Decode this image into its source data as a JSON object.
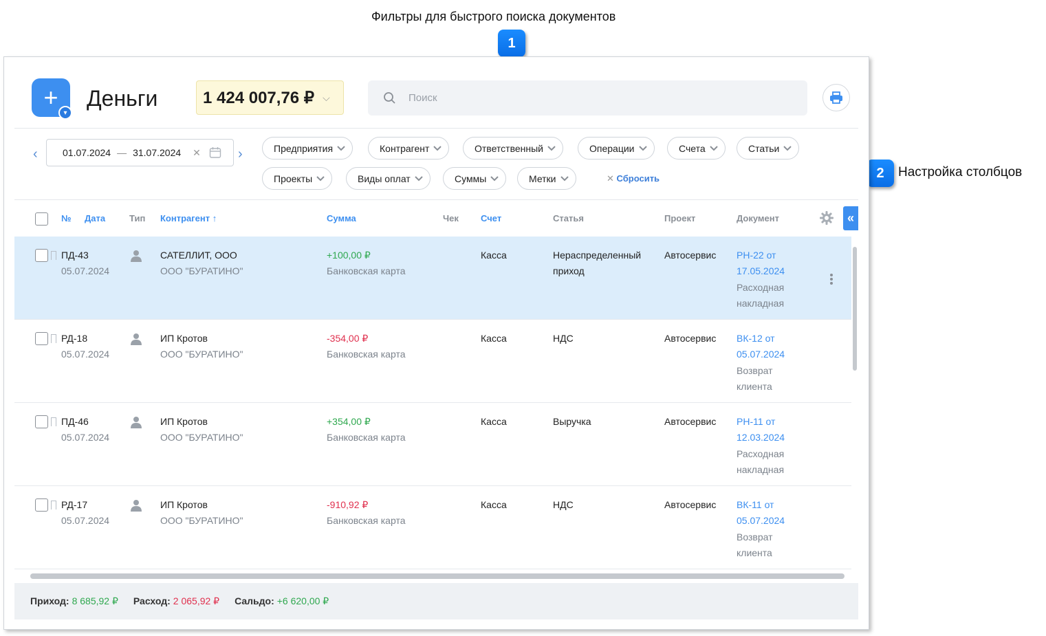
{
  "callouts": {
    "title": "Фильтры для быстрого поиска документов",
    "badge1": "1",
    "badge2": "2",
    "side_label": "Настройка столбцов"
  },
  "header": {
    "title": "Деньги",
    "balance": "1 424 007,76 ₽",
    "search_placeholder": "Поиск"
  },
  "period": {
    "from": "01.07.2024",
    "dash": "—",
    "to": "31.07.2024"
  },
  "filters": {
    "row1": [
      "Предприятия",
      "Контрагент",
      "Ответственный",
      "Операции",
      "Счета",
      "Статьи"
    ],
    "row2": [
      "Проекты",
      "Виды оплат",
      "Суммы",
      "Метки"
    ],
    "reset": "Сбросить"
  },
  "columns": {
    "num": "№",
    "date": "Дата",
    "type": "Тип",
    "counterparty": "Контрагент ↑",
    "sum": "Сумма",
    "check": "Чек",
    "account": "Счет",
    "article": "Статья",
    "project": "Проект",
    "document": "Документ"
  },
  "rows": [
    {
      "num": "ПД-43",
      "date": "05.07.2024",
      "counterparty": "САТЕЛЛИТ, ООО",
      "company": "ООО \"БУРАТИНО\"",
      "sum": "+100,00 ₽",
      "payment": "Банковская карта",
      "account": "Касса",
      "article_1": "Нераспределенный",
      "article_2": "приход",
      "project": "Автосервис",
      "doc_1": "РН-22 от",
      "doc_2": "17.05.2024",
      "doc_3": "Расходная",
      "doc_4": "накладная"
    },
    {
      "num": "РД-18",
      "date": "05.07.2024",
      "counterparty": "ИП Кротов",
      "company": "ООО \"БУРАТИНО\"",
      "sum": "-354,00 ₽",
      "payment": "Банковская карта",
      "account": "Касса",
      "article_1": "НДС",
      "article_2": "",
      "project": "Автосервис",
      "doc_1": "ВК-12 от",
      "doc_2": "05.07.2024",
      "doc_3": "Возврат",
      "doc_4": "клиента"
    },
    {
      "num": "ПД-46",
      "date": "05.07.2024",
      "counterparty": "ИП Кротов",
      "company": "ООО \"БУРАТИНО\"",
      "sum": "+354,00 ₽",
      "payment": "Банковская карта",
      "account": "Касса",
      "article_1": "Выручка",
      "article_2": "",
      "project": "Автосервис",
      "doc_1": "РН-11 от",
      "doc_2": "12.03.2024",
      "doc_3": "Расходная",
      "doc_4": "накладная"
    },
    {
      "num": "РД-17",
      "date": "05.07.2024",
      "counterparty": "ИП Кротов",
      "company": "ООО \"БУРАТИНО\"",
      "sum": "-910,92 ₽",
      "payment": "Банковская карта",
      "account": "Касса",
      "article_1": "НДС",
      "article_2": "",
      "project": "Автосервис",
      "doc_1": "ВК-11 от",
      "doc_2": "05.07.2024",
      "doc_3": "Возврат",
      "doc_4": "клиента"
    }
  ],
  "footer": {
    "income_label": "Приход:",
    "income": "8 685,92 ₽",
    "expense_label": "Расход:",
    "expense": "2 065,92 ₽",
    "balance_label": "Сальдо:",
    "balance": "+6 620,00 ₽"
  },
  "colors": {
    "accent": "#3d8ff0",
    "positive": "#2fa84f",
    "negative": "#e0304e",
    "selected_row": "#dcedfb",
    "balance_bg": "#fdf8db"
  }
}
